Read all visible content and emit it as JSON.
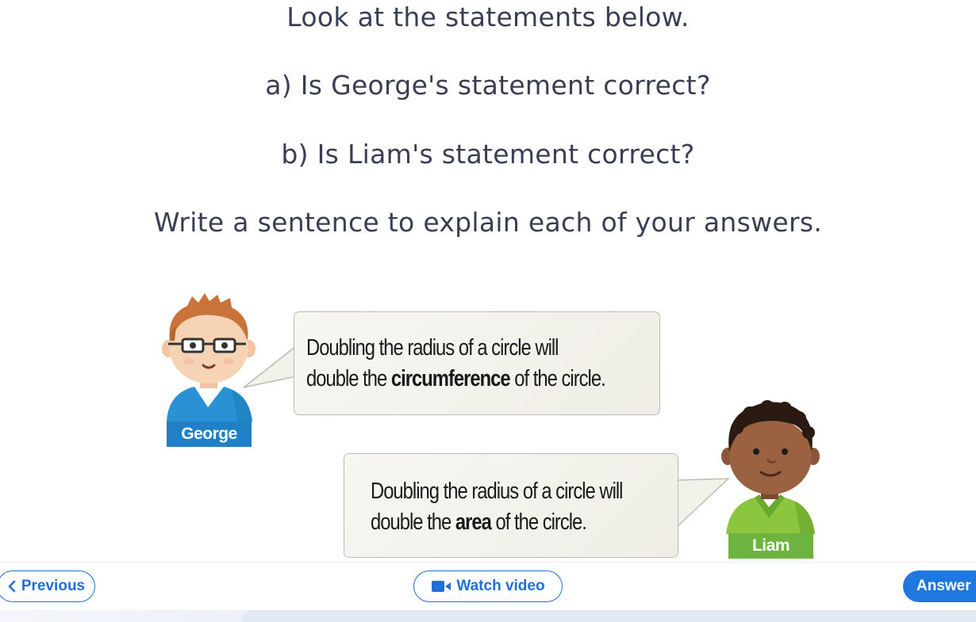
{
  "question": {
    "line1": "Look at the statements below.",
    "line2": "a) Is George's statement correct?",
    "line3": "b) Is Liam's statement correct?",
    "line4": "Write a sentence to explain each of your answers."
  },
  "george": {
    "name": "George",
    "statement_part1": "Doubling the radius of a circle will",
    "statement_part2_pre": "double the ",
    "statement_bold": "circumference",
    "statement_part2_post": " of the circle."
  },
  "liam": {
    "name": "Liam",
    "statement_part1": "Doubling the radius of a circle will",
    "statement_part2_pre": "double the ",
    "statement_bold": "area",
    "statement_part2_post": " of the circle."
  },
  "nav": {
    "previous_label": "Previous",
    "previous_icon": "chevron-left-icon",
    "watch_label": "Watch video",
    "watch_icon": "video-camera-icon",
    "answer_label": "Answer"
  },
  "colors": {
    "accent": "#1f6fd6",
    "answer_bg": "#1f78e0",
    "george_tag": "#1f80c6",
    "liam_tag": "#6db33f"
  }
}
